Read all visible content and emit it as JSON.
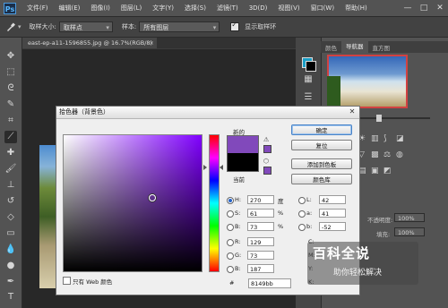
{
  "app": {
    "logo": "Ps"
  },
  "menubar": {
    "items": [
      "文件(F)",
      "编辑(E)",
      "图像(I)",
      "图层(L)",
      "文字(Y)",
      "选择(S)",
      "滤镜(T)",
      "3D(D)",
      "视图(V)",
      "窗口(W)",
      "帮助(H)"
    ],
    "window_controls": {
      "minimize": "—",
      "maximize": "□",
      "close": "✕"
    }
  },
  "options_bar": {
    "tool_icon": "eyedropper-icon",
    "sample_size_label": "取样大小:",
    "sample_size_value": "取样点",
    "sample_label": "样本:",
    "sample_value": "所有图层",
    "show_ring_label": "显示取样环",
    "show_ring_checked": true
  },
  "document": {
    "tab_title": "east-ep-a11-1596855.jpg @ 16.7%(RGB/8)",
    "close": "×"
  },
  "panels": {
    "tabs": [
      "颜色",
      "导航器",
      "直方图"
    ],
    "opacity_label": "不透明度:",
    "opacity_value": "100%",
    "fill_label": "填充:",
    "fill_value": "100%"
  },
  "color_picker": {
    "title": "拾色器（背景色）",
    "close": "✕",
    "new_label": "新的",
    "current_label": "当前",
    "new_color": "#8149bb",
    "current_color": "#000000",
    "buttons": {
      "ok": "确定",
      "reset": "复位",
      "add_swatch": "添加到色板",
      "color_libraries": "颜色库"
    },
    "only_web_colors": "只有 Web 颜色",
    "fields": {
      "H": {
        "label": "H:",
        "value": "270",
        "unit": "度"
      },
      "S": {
        "label": "S:",
        "value": "61",
        "unit": "%"
      },
      "B": {
        "label": "B:",
        "value": "73",
        "unit": "%"
      },
      "R": {
        "label": "R:",
        "value": "129"
      },
      "G": {
        "label": "G:",
        "value": "73"
      },
      "Bl": {
        "label": "B:",
        "value": "187"
      },
      "L": {
        "label": "L:",
        "value": "42"
      },
      "a": {
        "label": "a:",
        "value": "41"
      },
      "b": {
        "label": "b:",
        "value": "-52"
      },
      "C": {
        "label": "C:"
      },
      "M": {
        "label": "M:"
      },
      "Y": {
        "label": "Y:"
      },
      "K": {
        "label": "K:"
      }
    },
    "hex_label": "#",
    "hex_value": "8149bb",
    "selected_hue": 270
  },
  "watermark": {
    "main": "百科全说",
    "sub": "助你轻松解决"
  }
}
